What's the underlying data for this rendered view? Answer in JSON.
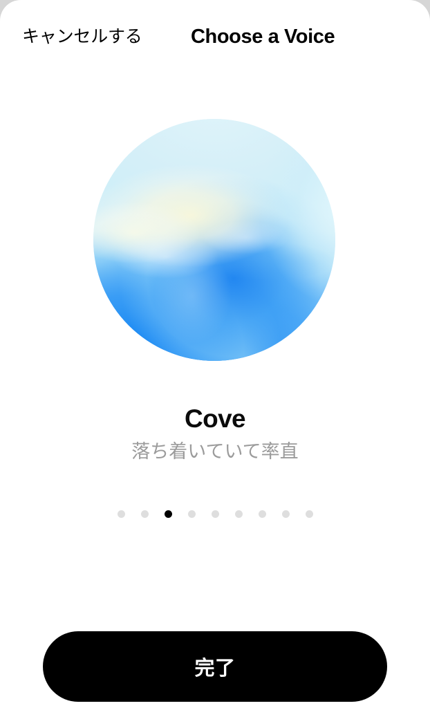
{
  "header": {
    "cancel_label": "キャンセルする",
    "title": "Choose a Voice"
  },
  "voice": {
    "name": "Cove",
    "description": "落ち着いていて率直",
    "orb_colors": {
      "top": "#d9f1f8",
      "cream": "#f8f7e0",
      "mid_blue": "#49a6f5",
      "deep_blue": "#0f80f2",
      "rim": "#e0f6fc"
    }
  },
  "pagination": {
    "count": 9,
    "active_index": 2,
    "active_color": "#000000",
    "inactive_color": "#dedede"
  },
  "footer": {
    "done_label": "完了",
    "background": "#000000",
    "text_color": "#ffffff"
  }
}
